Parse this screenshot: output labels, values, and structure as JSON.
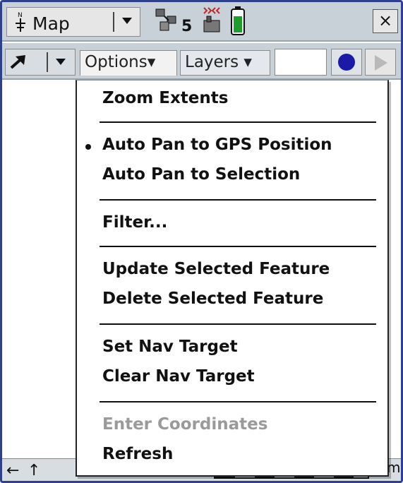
{
  "titlebar": {
    "section_label": "Map",
    "satellite_count": "5",
    "close_label": "×"
  },
  "toolbar": {
    "options_label": "Options▾",
    "layers_label": "Layers ▾"
  },
  "menu": {
    "items": [
      {
        "label": "Zoom Extents",
        "enabled": true,
        "checked": false
      },
      {
        "label": "Auto Pan to GPS Position",
        "enabled": true,
        "checked": true
      },
      {
        "label": "Auto Pan to Selection",
        "enabled": true,
        "checked": false
      },
      {
        "label": "Filter...",
        "enabled": true,
        "checked": false
      },
      {
        "label": "Update Selected Feature",
        "enabled": true,
        "checked": false
      },
      {
        "label": "Delete Selected Feature",
        "enabled": true,
        "checked": false
      },
      {
        "label": "Set Nav Target",
        "enabled": true,
        "checked": false
      },
      {
        "label": "Clear Nav Target",
        "enabled": true,
        "checked": false
      },
      {
        "label": "Enter Coordinates",
        "enabled": false,
        "checked": false
      },
      {
        "label": "Refresh",
        "enabled": true,
        "checked": false
      }
    ]
  },
  "bottombar": {
    "left_arrow": "←",
    "up_arrow": "↑",
    "scale_unit": "m"
  },
  "colors": {
    "record_dot": "#1a1aa8",
    "battery_fill": "#1f9d2a",
    "frame_border": "#2f3f8f"
  }
}
